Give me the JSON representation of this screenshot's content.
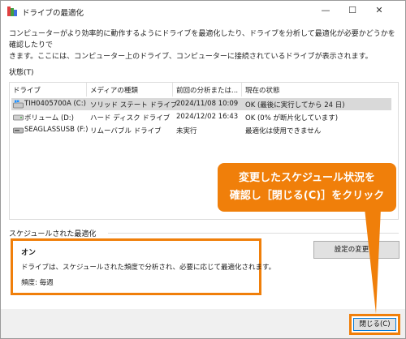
{
  "window": {
    "title": "ドライブの最適化",
    "minimize_icon": "minimize-icon",
    "maximize_icon": "maximize-icon",
    "close_icon": "close-icon"
  },
  "description": {
    "line1": "コンピューターがより効率的に動作するようにドライブを最適化したり、ドライブを分析して最適化が必要かどうかを確認したりで",
    "line2": "きます。ここには、コンピューター上のドライブ、コンピューターに接続されているドライブが表示されます。"
  },
  "status_label": "状態(T)",
  "table": {
    "headers": [
      "ドライブ",
      "メディアの種類",
      "前回の分析または...",
      "現在の状態"
    ],
    "rows": [
      {
        "drive": "TIH0405700A (C:)",
        "media": "ソリッド ステート ドライブ",
        "last": "2024/11/08 10:09",
        "status": "OK (最後に実行してから 24 日)",
        "icon": "windows-drive-icon",
        "selected": true
      },
      {
        "drive": "ボリューム (D:)",
        "media": "ハード ディスク ドライブ",
        "last": "2024/12/02 16:43",
        "status": "OK (0% が断片化しています)",
        "icon": "hard-drive-icon",
        "selected": false
      },
      {
        "drive": "SEAGLASSUSB (F:)",
        "media": "リムーバブル ドライブ",
        "last": "未実行",
        "status": "最適化は使用できません",
        "icon": "usb-drive-icon",
        "selected": false
      }
    ]
  },
  "schedule": {
    "section_label": "スケジュールされた最適化",
    "state": "オン",
    "description": "ドライブは、スケジュールされた頻度で分析され、必要に応じて最適化されます。",
    "frequency": "頻度: 毎週",
    "change_button": "設定の変更(S)"
  },
  "close_button": "閉じる(C)",
  "callout": {
    "line1": "変更したスケジュール状況を",
    "line2": "確認し［閉じる(C)］をクリック"
  },
  "colors": {
    "accent_orange": "#f07f0a",
    "selected_row": "#d9d9d9",
    "focus_blue": "#0078d7"
  }
}
